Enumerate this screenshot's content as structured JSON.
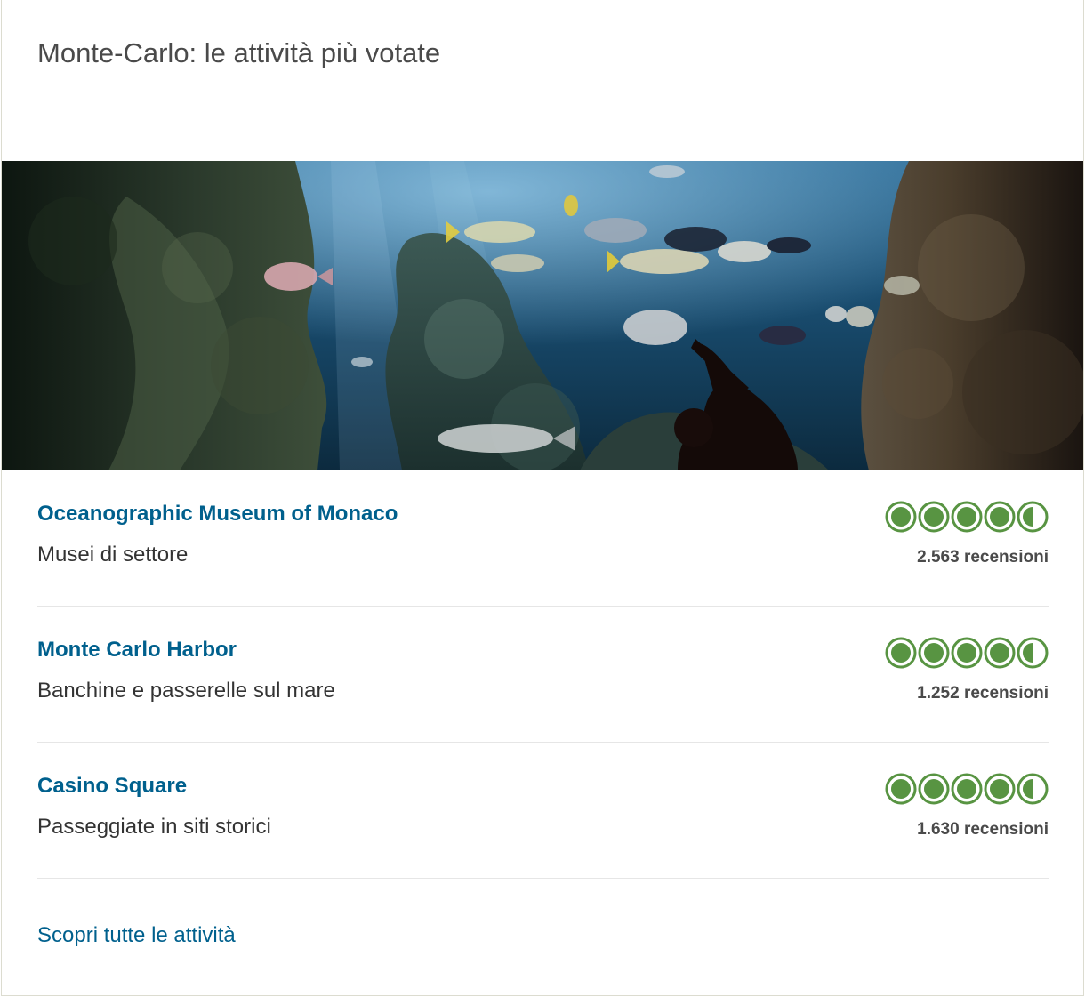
{
  "widget": {
    "title": "Monte-Carlo: le attività più votate",
    "see_all_label": "Scopri tutte le attività"
  },
  "hero": {
    "subject": "aquarium-photo"
  },
  "attractions": [
    {
      "name": "Oceanographic Museum of Monaco",
      "category": "Musei di settore",
      "reviews": "2.563 recensioni",
      "rating": 4.5
    },
    {
      "name": "Monte Carlo Harbor",
      "category": "Banchine e passerelle sul mare",
      "reviews": "1.252 recensioni",
      "rating": 4.5
    },
    {
      "name": "Casino Square",
      "category": "Passeggiate in siti storici",
      "reviews": "1.630 recensioni",
      "rating": 4.5
    }
  ],
  "colors": {
    "link": "#00608d",
    "rating": "#589442",
    "divider": "#e6e6e6"
  },
  "icons": {
    "rating_full": "bubble-full-icon",
    "rating_half": "bubble-half-icon"
  }
}
